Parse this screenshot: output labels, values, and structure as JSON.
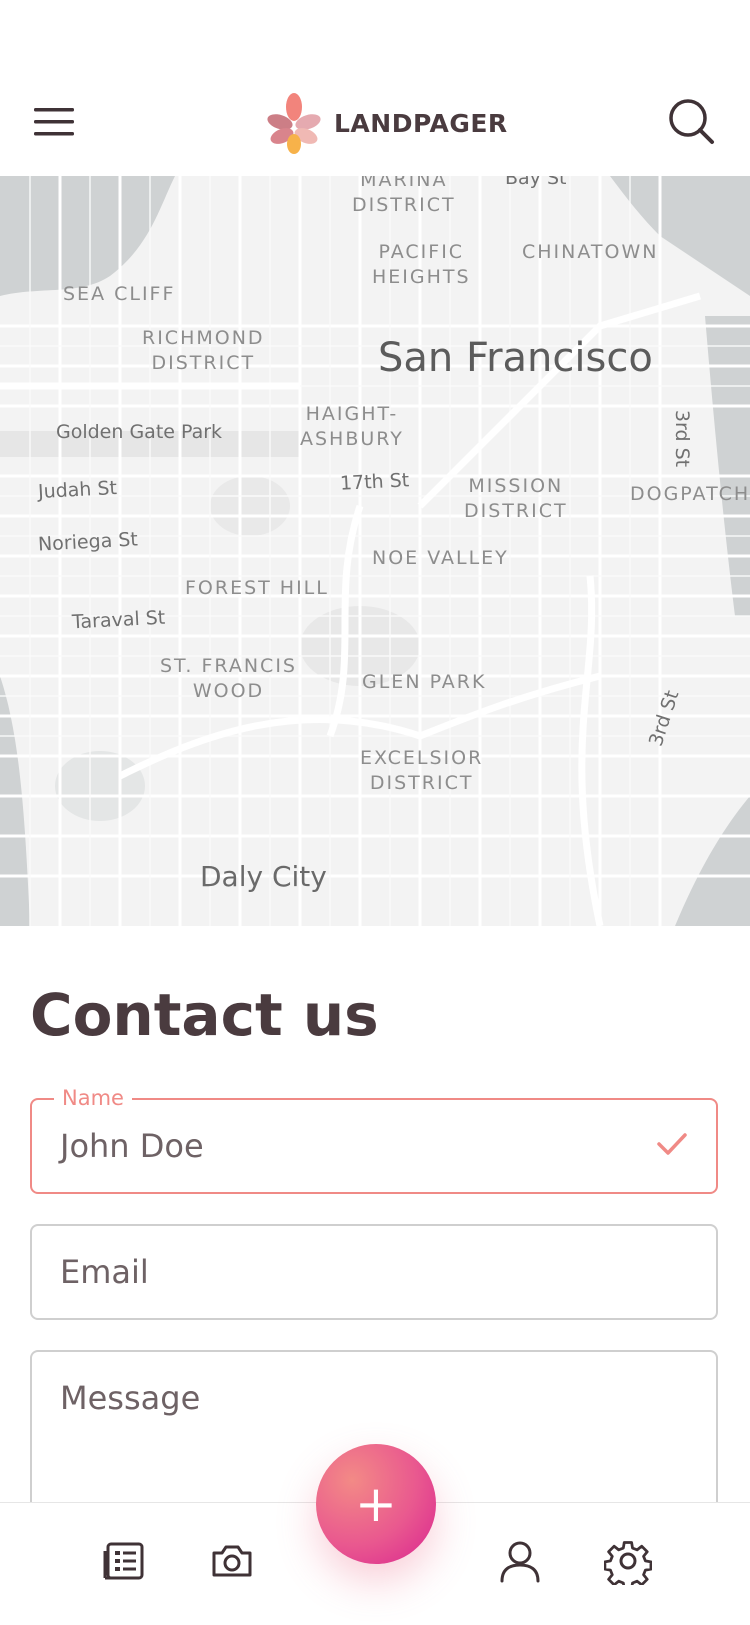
{
  "header": {
    "brand": "LANDPAGER",
    "menu_icon": "hamburger-menu-icon",
    "search_icon": "search-icon",
    "logo_icon": "flower-logo-icon"
  },
  "map": {
    "city": "San Francisco",
    "city_south": "Daly City",
    "neighborhoods": {
      "marina": "MARINA\nDISTRICT",
      "pacific_heights": "PACIFIC\nHEIGHTS",
      "chinatown": "CHINATOWN",
      "sea_cliff": "SEA CLIFF",
      "richmond": "RICHMOND\nDISTRICT",
      "haight": "HAIGHT-\nASHBURY",
      "mission": "MISSION\nDISTRICT",
      "dogpatch": "DOGPATCH",
      "noe_valley": "NOE VALLEY",
      "forest_hill": "FOREST HILL",
      "st_francis": "ST. FRANCIS\nWOOD",
      "glen_park": "GLEN PARK",
      "excelsior": "EXCELSIOR\nDISTRICT"
    },
    "streets": {
      "bay": "Bay St",
      "golden_gate_park": "Golden Gate Park",
      "judah": "Judah St",
      "noriega": "Noriega St",
      "taraval": "Taraval St",
      "seventeenth": "17th St",
      "third_a": "3rd St",
      "third_b": "3rd St"
    }
  },
  "contact": {
    "title": "Contact us",
    "name_label": "Name",
    "name_value": "John Doe",
    "email_placeholder": "Email",
    "message_placeholder": "Message"
  },
  "colors": {
    "accent": "#f08a86",
    "fab_gradient_end": "#d9248f",
    "text": "#4a3b3f"
  },
  "bottom_nav": {
    "items": [
      "list-icon",
      "camera-icon",
      "add-icon",
      "user-icon",
      "settings-icon"
    ],
    "fab_symbol": "+"
  }
}
